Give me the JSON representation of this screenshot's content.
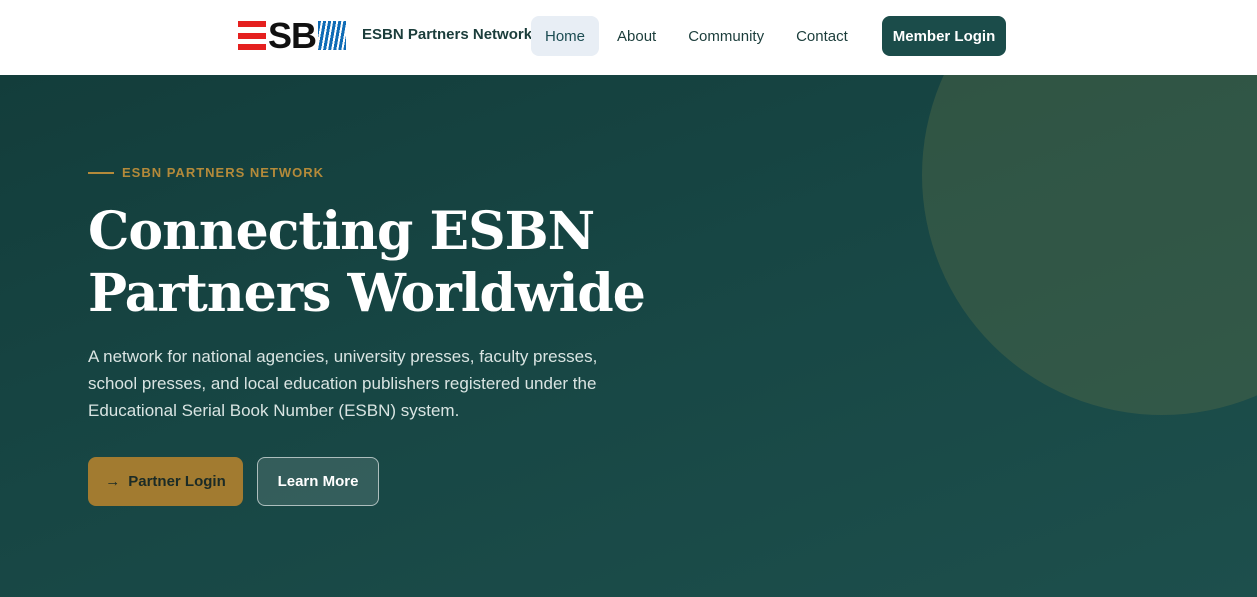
{
  "header": {
    "logo_text": "SB",
    "brand_name": "ESBN Partners Network",
    "nav": [
      {
        "label": "Home",
        "active": true
      },
      {
        "label": "About",
        "active": false
      },
      {
        "label": "Community",
        "active": false
      },
      {
        "label": "Contact",
        "active": false
      }
    ],
    "member_login_label": "Member Login"
  },
  "hero": {
    "eyebrow": "ESBN PARTNERS NETWORK",
    "headline_line1": "Connecting ESBN",
    "headline_line2": "Partners Worldwide",
    "description": "A network for national agencies, university presses, faculty presses, school presses, and local education publishers registered under the Educational Serial Book Number (ESBN) system.",
    "primary_button": {
      "label": "Partner Login",
      "icon": "arrow-right-icon"
    },
    "secondary_button": {
      "label": "Learn More"
    }
  },
  "colors": {
    "accent_gold": "#b48a3a",
    "dark_teal": "#1b4c4a",
    "logo_red": "#e5201f",
    "logo_blue": "#0f6cb6"
  }
}
